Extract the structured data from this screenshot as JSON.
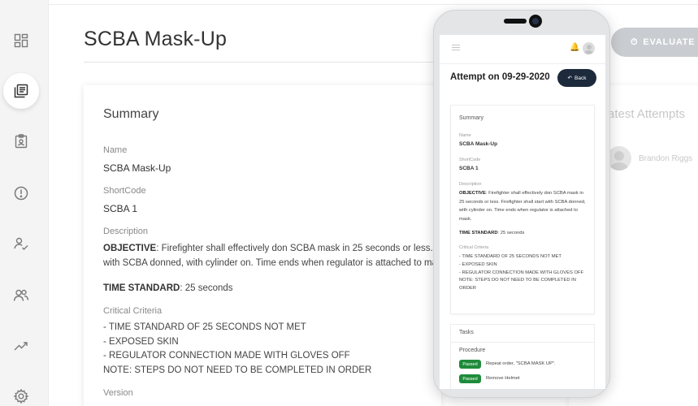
{
  "page": {
    "title": "SCBA Mask-Up"
  },
  "sidebar": {
    "items": [
      {
        "icon": "dashboard-icon"
      },
      {
        "icon": "library-icon",
        "active": true
      },
      {
        "icon": "clipboard-icon"
      },
      {
        "icon": "alert-icon"
      },
      {
        "icon": "user-check-icon"
      },
      {
        "icon": "users-icon"
      },
      {
        "icon": "trending-icon"
      },
      {
        "icon": "gear-icon"
      }
    ]
  },
  "summary": {
    "heading": "Summary",
    "name_label": "Name",
    "name_value": "SCBA Mask-Up",
    "shortcode_label": "ShortCode",
    "shortcode_value": "SCBA 1",
    "description_label": "Description",
    "objective_label": "OBJECTIVE",
    "objective_line1": ": Firefighter shall effectively don SCBA mask in 25 seconds or less. Firefig",
    "objective_line2": "with SCBA donned, with cylinder on. Time ends when regulator is attached to mask",
    "time_standard_label": "TIME STANDARD",
    "time_standard_value": ": 25 seconds",
    "critical_label": "Critical Criteria",
    "critical_lines": [
      "- TIME STANDARD OF 25 SECONDS NOT MET",
      "- EXPOSED SKIN",
      "- REGULATOR CONNECTION MADE WITH GLOVES OFF",
      "NOTE: STEPS DO NOT NEED TO BE COMPLETED IN ORDER"
    ],
    "version_label": "Version"
  },
  "right_panel": {
    "evaluate_label": "EVALUATE I",
    "latest_title": "atest Attempts",
    "latest_name": "Brandon Riggs"
  },
  "phone": {
    "attempt_title": "Attempt on 09-29-2020",
    "back_label": "Back",
    "summary_heading": "Summary",
    "name_label": "Name",
    "name_value": "SCBA Mask-Up",
    "shortcode_label": "ShortCode",
    "shortcode_value": "SCBA 1",
    "description_label": "Description",
    "objective_label": "OBJECTIVE",
    "objective_text": ": Firefighter shall effectively don SCBA mask in 25 seconds or less. Firefighter shall start with SCBA donned, with cylinder on. Time ends when regulator is attached to mask.",
    "time_standard_label": "TIME STANDARD",
    "time_standard_value": ": 25 seconds",
    "critical_label": "Critical Criteria",
    "critical_lines": [
      "- TIME STANDARD OF 25 SECONDS NOT MET",
      "- EXPOSED SKIN",
      "- REGULATOR CONNECTION MADE WITH GLOVES OFF",
      "NOTE: STEPS DO NOT NEED TO BE COMPLETED IN ORDER"
    ],
    "tasks_heading": "Tasks",
    "procedure_label": "Procedure",
    "tasks": [
      {
        "status": "Passed",
        "text": "Repeat order, \"SCBA MASK UP\"."
      },
      {
        "status": "Passed",
        "text": "Remove Helmet"
      }
    ]
  }
}
